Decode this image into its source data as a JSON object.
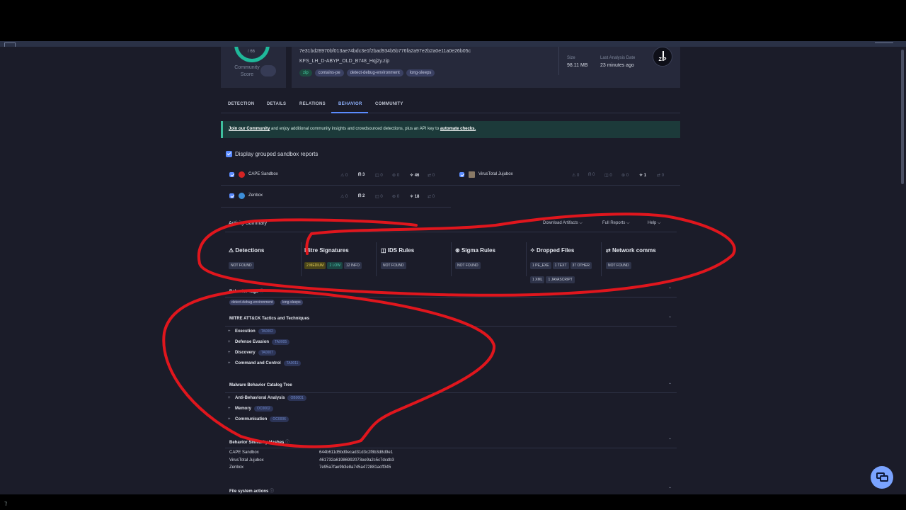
{
  "header": {
    "score_detected": "/ 66",
    "community_score_label": "Community Score",
    "hash": "7e31bd28970bf013ae74bdc3e1f2bad934b5b776fa2a97e2b2a0e11a0e26b05c",
    "filename": "KFS_LH_D-ABYP_OLD_B748_Hqj2y.zip",
    "tags": [
      "zip",
      "contains-pe",
      "detect-debug-environment",
      "long-sleeps"
    ],
    "size_label": "Size",
    "size_value": "98.11 MB",
    "last_analysis_label": "Last Analysis Date",
    "last_analysis_value": "23 minutes ago",
    "file_type": "ZIP"
  },
  "tabs": [
    "DETECTION",
    "DETAILS",
    "RELATIONS",
    "BEHAVIOR",
    "COMMUNITY"
  ],
  "banner": {
    "link1": "Join our Community",
    "middle": " and enjoy additional community insights and crowdsourced detections, plus an API key to ",
    "link2": "automate checks."
  },
  "grouped_label": "Display grouped sandbox reports",
  "sandboxes": [
    {
      "name": "CAPE Sandbox",
      "metrics": [
        "0",
        "3",
        "0",
        "0",
        "46",
        "0"
      ]
    },
    {
      "name": "VirusTotal Jujubox",
      "metrics": [
        "0",
        "0",
        "0",
        "0",
        "1",
        "0"
      ]
    },
    {
      "name": "Zenbox",
      "metrics": [
        "0",
        "2",
        "0",
        "0",
        "18",
        "0"
      ]
    }
  ],
  "activity": {
    "title": "Activity Summary",
    "download": "Download Artifacts",
    "full_reports": "Full Reports",
    "help": "Help"
  },
  "stats": [
    {
      "title": "Detections",
      "icon": "⚠",
      "pills": [
        "NOT FOUND"
      ]
    },
    {
      "title": "Mitre Signatures",
      "icon": "",
      "pills": [
        "2 MEDIUM",
        "2 LOW",
        "12 INFO"
      ]
    },
    {
      "title": "IDS Rules",
      "icon": "◫",
      "pills": [
        "NOT FOUND"
      ]
    },
    {
      "title": "Sigma Rules",
      "icon": "⊛",
      "pills": [
        "NOT FOUND"
      ]
    },
    {
      "title": "Dropped Files",
      "icon": "✧",
      "pills": [
        "1 PE_EXE",
        "1 TEXT",
        "37 OTHER",
        "1 XML",
        "1 JAVASCRIPT"
      ]
    },
    {
      "title": "Network comms",
      "icon": "⇄",
      "pills": [
        "NOT FOUND"
      ]
    }
  ],
  "behavior_tags": {
    "title": "Behavior Tags",
    "tags": [
      "detect-debug-environment",
      "long-sleeps"
    ]
  },
  "mitre": {
    "title": "MITRE ATT&CK Tactics and Techniques",
    "items": [
      {
        "label": "Execution",
        "code": "TA0002"
      },
      {
        "label": "Defense Evasion",
        "code": "TA0005"
      },
      {
        "label": "Discovery",
        "code": "TA0007"
      },
      {
        "label": "Command and Control",
        "code": "TA0011"
      }
    ]
  },
  "mbc": {
    "title": "Malware Behavior Catalog Tree",
    "items": [
      {
        "label": "Anti-Behavioral Analysis",
        "code": "OB0001"
      },
      {
        "label": "Memory",
        "code": "OC0002"
      },
      {
        "label": "Communication",
        "code": "OC0006"
      }
    ]
  },
  "similarity": {
    "title": "Behavior Similarity Hashes",
    "rows": [
      {
        "name": "CAPE Sandbox",
        "hash": "644b611d5bd9ecad31d3c2f8b3d8d9e1"
      },
      {
        "name": "VirusTotal Jujubox",
        "hash": "461732a61986992073ee9a2c5c7dcdb3"
      },
      {
        "name": "Zenbox",
        "hash": "7e95a7fae9b3e8a745a472881acff345"
      }
    ]
  },
  "file_system": {
    "title": "File system actions"
  },
  "colors": {
    "annotation": "#e0161d",
    "accent": "#5b8cff",
    "background": "#1b1c29"
  }
}
